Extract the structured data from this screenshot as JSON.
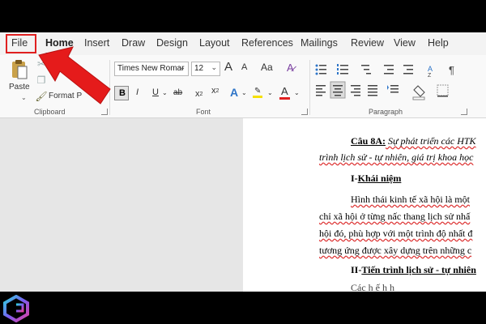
{
  "tabs": [
    "File",
    "Home",
    "Insert",
    "Draw",
    "Design",
    "Layout",
    "References",
    "Mailings",
    "Review",
    "View",
    "Help"
  ],
  "active_tab": "Home",
  "clipboard": {
    "paste_label": "Paste",
    "format_painter_label": "Format P",
    "group_label": "Clipboard"
  },
  "font": {
    "font_name": "Times New Romar",
    "font_size": "12",
    "grow_label": "A",
    "shrink_label": "A",
    "case_label": "Aa",
    "bold_label": "B",
    "italic_label": "I",
    "underline_label": "U",
    "strike_label": "ab",
    "subscript_label": "x",
    "superscript_label": "x",
    "effects_label": "A",
    "highlight_label": "ab",
    "font_color_label": "A",
    "group_label": "Font"
  },
  "paragraph": {
    "group_label": "Paragraph"
  },
  "document": {
    "lines": [
      {
        "prefix": "Câu 8A:",
        "text": " Sự phát triển các HTK"
      },
      {
        "text": "trình lịch sử - tự nhiên, giá trị khoa học"
      },
      {
        "prefix": "I-",
        "text": "Khái niệm"
      },
      {
        "text": "Hình thái kinh tế xã hội là một"
      },
      {
        "text": "chỉ xã hội ở từng nấc thang lịch sử nhấ"
      },
      {
        "text": "hội đó, phù hợp với một trình độ nhất đ"
      },
      {
        "text": "tương ứng được xây dựng trên những c"
      },
      {
        "prefix": "II-",
        "text": "Tiến trình lịch sử - tự nhiên"
      },
      {
        "text": "Các h                    ế       h     h"
      }
    ]
  },
  "colors": {
    "accent": "#2b579a",
    "arrow": "#e51b1b",
    "highlight_callout": "#e02020"
  }
}
